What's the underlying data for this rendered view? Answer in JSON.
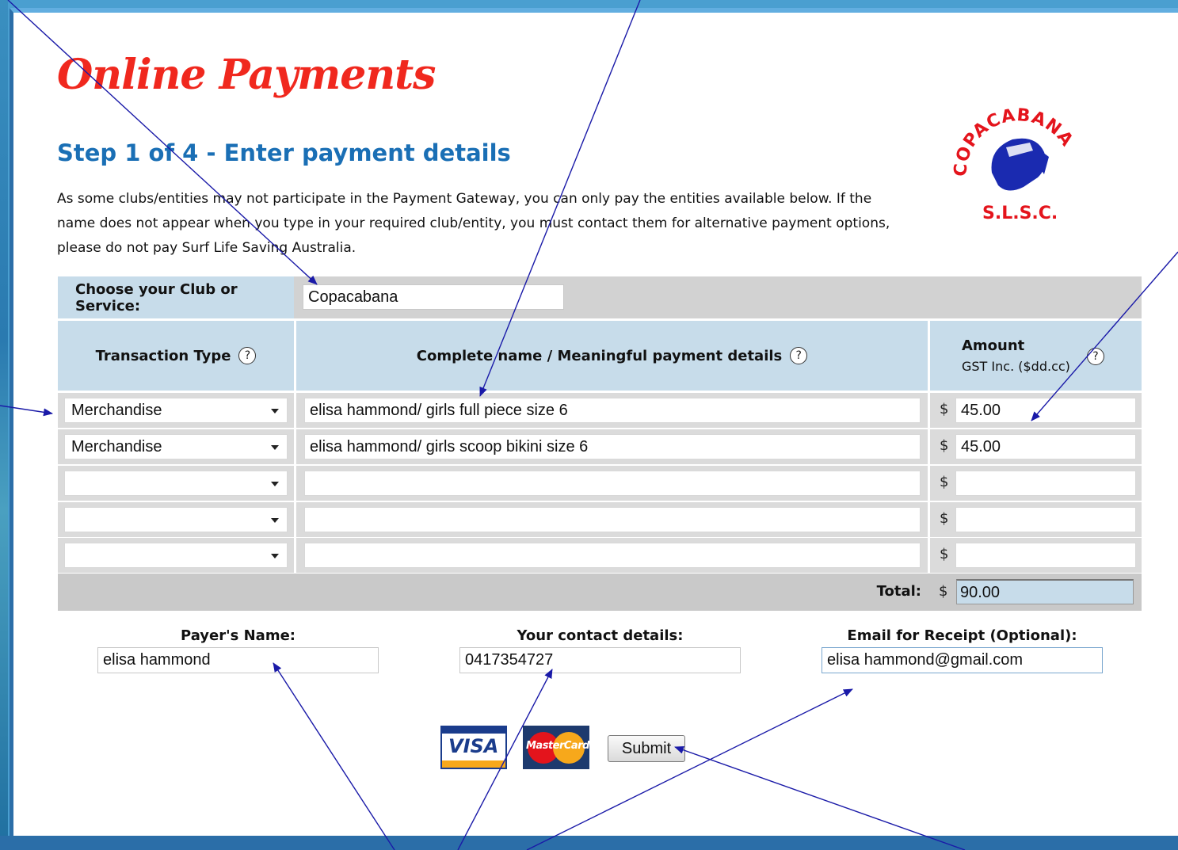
{
  "page": {
    "title": "Online Payments",
    "step": "Step 1 of 4 - Enter payment details",
    "intro": "As some clubs/entities may not participate in the Payment Gateway, you can only pay the entities available below. If the name does not appear when you type in your required club/entity, you must contact them for alternative payment options, please do not pay Surf Life Saving Australia."
  },
  "logo": {
    "top_text": "COPACABANA",
    "bottom_text": "S.L.S.C."
  },
  "club": {
    "label": "Choose your Club or Service:",
    "value": "Copacabana"
  },
  "columns": {
    "transaction_type": "Transaction Type",
    "details": "Complete name / Meaningful payment details",
    "amount": "Amount",
    "amount_sub": "GST Inc. ($dd.cc)",
    "help": "?"
  },
  "rows": [
    {
      "type": "Merchandise",
      "details": "elisa hammond/ girls full piece size 6",
      "currency": "$",
      "amount": "45.00"
    },
    {
      "type": "Merchandise",
      "details": "elisa hammond/ girls scoop bikini size 6",
      "currency": "$",
      "amount": "45.00"
    },
    {
      "type": "",
      "details": "",
      "currency": "$",
      "amount": ""
    },
    {
      "type": "",
      "details": "",
      "currency": "$",
      "amount": ""
    },
    {
      "type": "",
      "details": "",
      "currency": "$",
      "amount": ""
    }
  ],
  "total": {
    "label": "Total:",
    "currency": "$",
    "value": "90.00"
  },
  "payer": {
    "label": "Payer's Name:",
    "value": "elisa hammond"
  },
  "contact": {
    "label": "Your contact details:",
    "value": "0417354727"
  },
  "email": {
    "label": "Email for Receipt (Optional):",
    "value": "elisa hammond@gmail.com"
  },
  "cards": {
    "visa": "VISA",
    "mastercard": "MasterCard"
  },
  "submit": {
    "label": "Submit"
  },
  "colors": {
    "title": "#f0281e",
    "step": "#1a6fb5",
    "header_bg": "#c7dcea",
    "arrow": "#1a1aa8"
  }
}
